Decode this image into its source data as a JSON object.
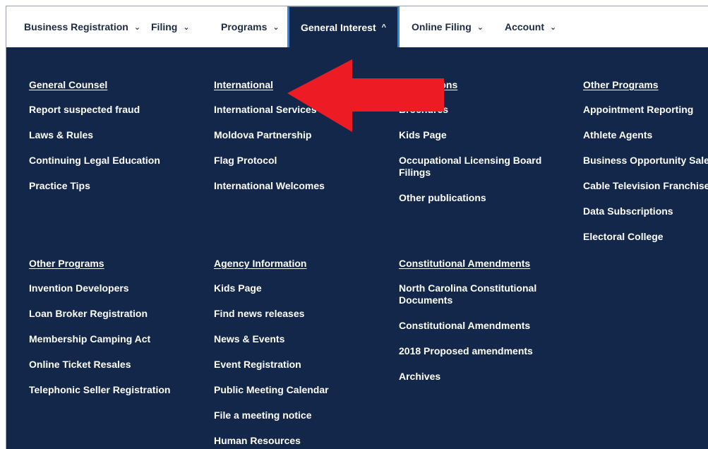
{
  "nav": {
    "items": [
      {
        "label": "Business Registration",
        "chevron": "⌄"
      },
      {
        "label": "Filing",
        "chevron": "⌄"
      },
      {
        "label": "Programs",
        "chevron": "⌄"
      },
      {
        "label": "General Interest",
        "chevron": "^"
      },
      {
        "label": "Online Filing",
        "chevron": "⌄"
      },
      {
        "label": "Account",
        "chevron": "⌄"
      }
    ],
    "active_index": 3
  },
  "menu": {
    "row1": [
      {
        "heading": "General Counsel",
        "links": [
          "Report suspected fraud",
          "Laws & Rules",
          "Continuing Legal Education",
          "Practice Tips"
        ]
      },
      {
        "heading": "International",
        "links": [
          "International Services",
          "Moldova Partnership",
          "Flag Protocol",
          "International Welcomes"
        ]
      },
      {
        "heading": "Publications",
        "links": [
          "Brochures",
          "Kids Page",
          "Occupational Licensing Board Filings",
          "Other publications"
        ]
      },
      {
        "heading": "Other Programs",
        "links": [
          "Appointment Reporting",
          "Athlete Agents",
          "Business Opportunity Sales",
          "Cable Television Franchises",
          "Data Subscriptions",
          "Electoral College"
        ]
      }
    ],
    "row2": [
      {
        "heading": "Other Programs",
        "links": [
          "Invention Developers",
          "Loan Broker Registration",
          "Membership Camping Act",
          "Online Ticket Resales",
          "Telephonic Seller Registration"
        ]
      },
      {
        "heading": "Agency Information",
        "links": [
          "Kids Page",
          "Find news releases",
          "News & Events",
          "Event Registration",
          "Public Meeting Calendar",
          "File a meeting notice",
          "Human Resources"
        ]
      },
      {
        "heading": "Constitutional Amendments",
        "links": [
          "North Carolina Constitutional Documents",
          "Constitutional Amendments",
          "2018 Proposed amendments",
          "Archives"
        ]
      }
    ]
  },
  "colors": {
    "panel_bg": "#13274a",
    "active_border": "#2f86e0",
    "arrow": "#ed1c24"
  },
  "annotation": {
    "icon": "red-arrow-icon"
  }
}
